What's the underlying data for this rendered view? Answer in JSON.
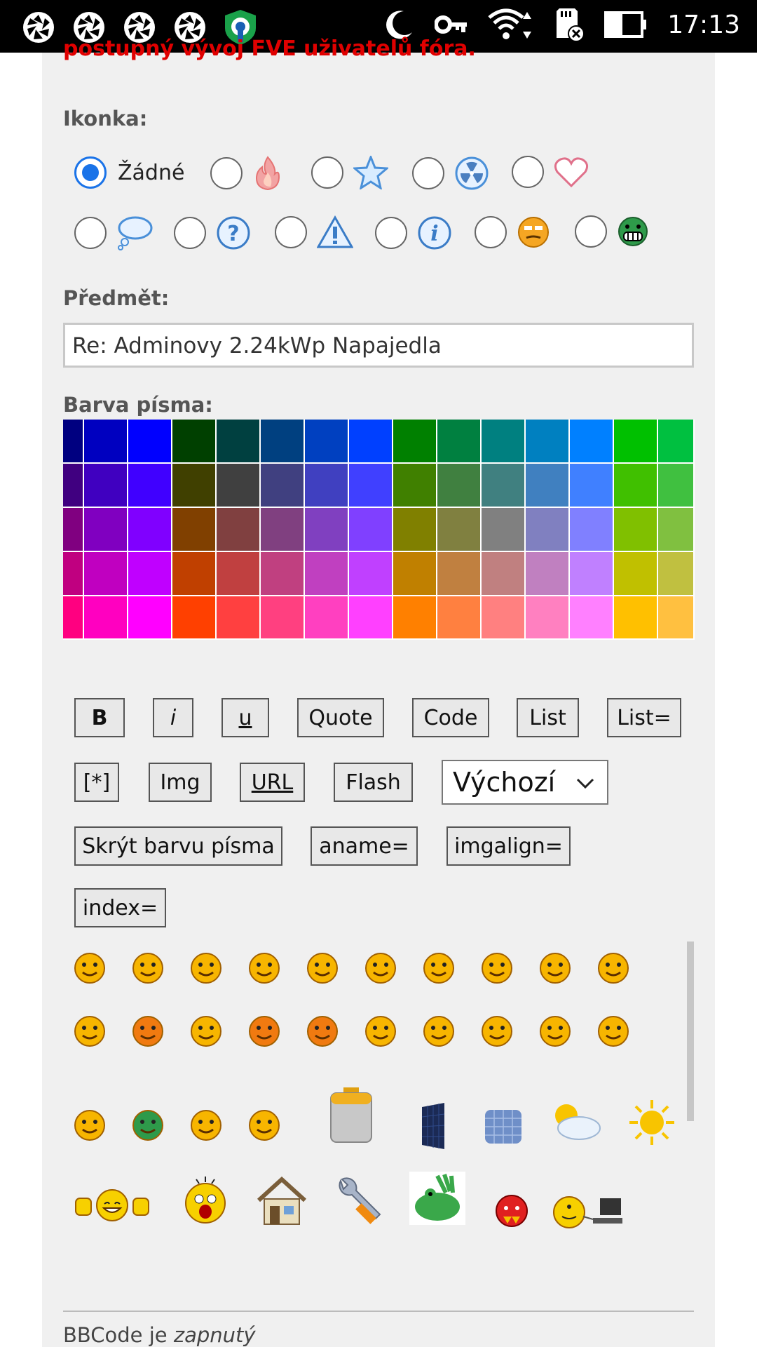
{
  "status_bar": {
    "time": "17:13",
    "left_icons": [
      "aperture-icon",
      "aperture-icon",
      "aperture-icon",
      "aperture-icon",
      "vpn-key-icon"
    ],
    "right_icons": [
      "moon-icon",
      "key-icon",
      "wifi-icon",
      "sd-card-icon",
      "battery-icon"
    ]
  },
  "header_text": "postupný vývoj FVE uživatelů fóra.",
  "icon_section": {
    "label": "Ikonka:",
    "options": [
      {
        "label": "Žádné",
        "icon": "none",
        "checked": true
      },
      {
        "icon": "fire-icon",
        "checked": false
      },
      {
        "icon": "star-icon",
        "checked": false
      },
      {
        "icon": "radioactive-icon",
        "checked": false
      },
      {
        "icon": "heart-icon",
        "checked": false
      },
      {
        "icon": "speech-bubble-icon",
        "checked": false
      },
      {
        "icon": "question-icon",
        "checked": false
      },
      {
        "icon": "warning-icon",
        "checked": false
      },
      {
        "icon": "info-icon",
        "checked": false
      },
      {
        "icon": "tongue-smiley-icon",
        "checked": false
      },
      {
        "icon": "grin-green-icon",
        "checked": false
      }
    ]
  },
  "subject": {
    "label": "Předmět:",
    "value": "Re: Adminovy 2.24kWp Napajedla"
  },
  "font_color": {
    "label": "Barva písma:",
    "palette": [
      [
        "#000080",
        "#0000c0",
        "#0000ff",
        "#004000",
        "#004040",
        "#004080",
        "#0040c0",
        "#0040ff",
        "#008000",
        "#008040",
        "#008080",
        "#0080c0",
        "#0080ff",
        "#00c000",
        "#00c040"
      ],
      [
        "#400080",
        "#4000c0",
        "#4000ff",
        "#404000",
        "#404040",
        "#404080",
        "#4040c0",
        "#4040ff",
        "#408000",
        "#408040",
        "#408080",
        "#4080c0",
        "#4080ff",
        "#40c000",
        "#40c040"
      ],
      [
        "#800080",
        "#8000c0",
        "#8000ff",
        "#804000",
        "#804040",
        "#804080",
        "#8040c0",
        "#8040ff",
        "#808000",
        "#808040",
        "#808080",
        "#8080c0",
        "#8080ff",
        "#80c000",
        "#80c040"
      ],
      [
        "#c00080",
        "#c000c0",
        "#c000ff",
        "#c04000",
        "#c04040",
        "#c04080",
        "#c040c0",
        "#c040ff",
        "#c08000",
        "#c08040",
        "#c08080",
        "#c080c0",
        "#c080ff",
        "#c0c000",
        "#c0c040"
      ],
      [
        "#ff0080",
        "#ff00c0",
        "#ff00ff",
        "#ff4000",
        "#ff4040",
        "#ff4080",
        "#ff40c0",
        "#ff40ff",
        "#ff8000",
        "#ff8040",
        "#ff8080",
        "#ff80c0",
        "#ff80ff",
        "#ffc000",
        "#ffc040"
      ]
    ]
  },
  "bbcode_buttons": [
    {
      "label": "B",
      "style": "bold"
    },
    {
      "label": "i",
      "style": "ital"
    },
    {
      "label": "u",
      "style": "und"
    },
    {
      "label": "Quote",
      "style": ""
    },
    {
      "label": "Code",
      "style": ""
    },
    {
      "label": "List",
      "style": ""
    },
    {
      "label": "List=",
      "style": ""
    },
    {
      "label": "[*]",
      "style": ""
    },
    {
      "label": "Img",
      "style": ""
    },
    {
      "label": "URL",
      "style": "und"
    },
    {
      "label": "Flash",
      "style": ""
    },
    {
      "label": "Skrýt barvu písma",
      "style": ""
    },
    {
      "label": "aname=",
      "style": ""
    },
    {
      "label": "imgalign=",
      "style": ""
    },
    {
      "label": "index=",
      "style": ""
    }
  ],
  "font_size_select": {
    "value": "Výchozí"
  },
  "smileys": [
    "grin-smiley-icon",
    "smile-smiley-icon",
    "wink-smiley-icon",
    "sad-smiley-icon",
    "shocked-smiley-icon",
    "eek-smiley-icon",
    "confused-smiley-icon",
    "cool-smiley-icon",
    "laugh-smiley-icon",
    "mad-smiley-icon",
    "razz-smiley-icon",
    "embarrassed-smiley-icon",
    "neutral-frown-smiley-icon",
    "evil-smiley-icon",
    "twisted-smiley-icon",
    "rolleyes-smiley-icon",
    "exclaim-smiley-icon",
    "question-smiley-icon",
    "idea-smiley-icon",
    "arrow-smiley-icon",
    "neutral-smiley-icon",
    "green-grin-smiley-icon",
    "nerd-smiley-icon",
    "geek-smiley-icon",
    "battery-icon",
    "solar-panel-dark-icon",
    "solar-panel-blue-icon",
    "cloudy-sun-icon",
    "sun-icon",
    "thumbs-up-smiley-icon",
    "scared-smiley-icon",
    "house-icon",
    "wrench-icon",
    "frog-hand-icon",
    "red-devil-icon",
    "computer-smiley-icon"
  ],
  "footer": {
    "prefix": "BBCode",
    "middle": "je",
    "status": "zapnutý"
  }
}
